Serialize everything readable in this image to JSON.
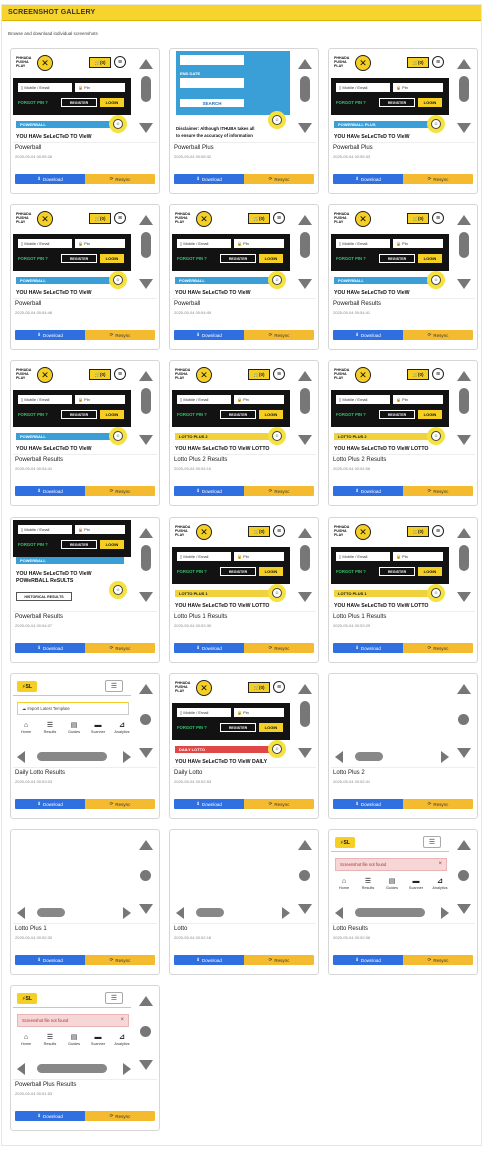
{
  "header": {
    "title": "SCREENSHOT GALLERY",
    "subtitle": "Browse and download individual screenshots"
  },
  "actions": {
    "download": "Download",
    "resync": "Resync"
  },
  "app": {
    "logo": [
      "PHHADA",
      "PUSHA",
      "PLAY"
    ],
    "cart": "(0)",
    "mobile_placeholder": "Mobile / Email",
    "pin_placeholder": "Pin",
    "forgot": "FORGOT PIN ?",
    "register": "REGISTER",
    "login": "LOGIN",
    "selected_prefix": "YOU HAVe SeLeCTeD TO VIeW",
    "end_date": "END DATE",
    "search": "SEARCH",
    "disclaimer_1": "Disclaimer: Although ITHUBA takes all",
    "disclaimer_2": "to ensure the accuracy of information",
    "powerball_results_heading": "YOU HAVe SeLeCTeD TO VIeW",
    "powerball_results_heading2": "POWeRBALL ReSULTS",
    "historical": "HISTORICAL RESULTS"
  },
  "sl": {
    "logo": "SL",
    "import_label": "Import Latest Template",
    "not_found": "Screenshot file not found",
    "nav": [
      "Home",
      "Results",
      "Guides",
      "Scanner",
      "Analytics"
    ]
  },
  "cards": [
    {
      "title": "Powerball",
      "date": "2025-05-04 00:55:26",
      "kind": "lottery",
      "strip": "POWERBALL",
      "strip_color": "blue",
      "selected": "YOU HAVe SeLeCTeD TO VIeW"
    },
    {
      "title": "Powerball Plus",
      "date": "2025-05-04 00:55:32",
      "kind": "pbplus"
    },
    {
      "title": "Powerball Plus",
      "date": "2025-05-04 00:55:33",
      "kind": "lottery",
      "strip": "POWERBALL PLUS",
      "strip_color": "blue",
      "selected": "YOU HAVe SeLeCTeD TO VIeW"
    },
    {
      "title": "Powerball",
      "date": "2025-05-04 00:54:46",
      "kind": "lottery",
      "strip": "POWERBALL",
      "strip_color": "blue",
      "selected": "YOU HAVe SeLeCTeD TO VIeW"
    },
    {
      "title": "Powerball",
      "date": "2025-05-04 00:54:49",
      "kind": "lottery",
      "strip": "POWERBALL",
      "strip_color": "blue",
      "selected": "YOU HAVe SeLeCTeD TO VIeW"
    },
    {
      "title": "Powerball Results",
      "date": "2025-05-04 00:54:41",
      "kind": "lottery",
      "strip": "POWERBALL",
      "strip_color": "blue",
      "selected": "YOU HAVe SeLeCTeD TO VIeW"
    },
    {
      "title": "Powerball Results",
      "date": "2025-05-04 00:54:41",
      "kind": "lottery",
      "strip": "POWERBALL",
      "strip_color": "blue",
      "selected": "YOU HAVe SeLeCTeD TO VIeW"
    },
    {
      "title": "Lotto Plus 2 Results",
      "date": "2025-05-04 00:54:10",
      "kind": "lottery",
      "strip": "LOTTO PLUS 2",
      "strip_color": "yellow",
      "selected": "YOU HAVe SeLeCTeD TO VIeW LOTTO"
    },
    {
      "title": "Lotto Plus 2 Results",
      "date": "2025-05-04 00:54:06",
      "kind": "lottery",
      "strip": "LOTTO PLUS 2",
      "strip_color": "yellow",
      "selected": "YOU HAVe SeLeCTeD TO VIeW LOTTO"
    },
    {
      "title": "Powerball Results",
      "date": "2025-05-04 00:54:07",
      "kind": "pbresults"
    },
    {
      "title": "Lotto Plus 1 Results",
      "date": "2025-05-04 00:53:30",
      "kind": "lottery",
      "strip": "LOTTO PLUS 1",
      "strip_color": "yellow",
      "selected": "YOU HAVe SeLeCTeD TO VIeW LOTTO"
    },
    {
      "title": "Lotto Plus 1 Results",
      "date": "2025-05-04 00:53:29",
      "kind": "lottery",
      "strip": "LOTTO PLUS 1",
      "strip_color": "yellow",
      "selected": "YOU HAVe SeLeCTeD TO VIeW LOTTO"
    },
    {
      "title": "Daily Lotto Results",
      "date": "2025-05-04 00:53:03",
      "kind": "sl_import"
    },
    {
      "title": "Daily Lotto",
      "date": "2025-05-04 00:52:53",
      "kind": "lottery",
      "strip": "DAILY LOTTO",
      "strip_color": "red",
      "selected": "YOU HAVe SeLeCTeD TO VIeW DAILY"
    },
    {
      "title": "Lotto Plus 2",
      "date": "2025-05-04 00:52:41",
      "kind": "blank_h"
    },
    {
      "title": "Lotto Plus 1",
      "date": "2025-05-04 00:52:30",
      "kind": "blank_v"
    },
    {
      "title": "Lotto",
      "date": "2025-05-04 00:52:18",
      "kind": "blank_v"
    },
    {
      "title": "Lotto Results",
      "date": "2025-05-04 00:52:06",
      "kind": "sl_err"
    },
    {
      "title": "Powerball Plus Results",
      "date": "2025-05-04 00:51:53",
      "kind": "sl_err"
    }
  ]
}
